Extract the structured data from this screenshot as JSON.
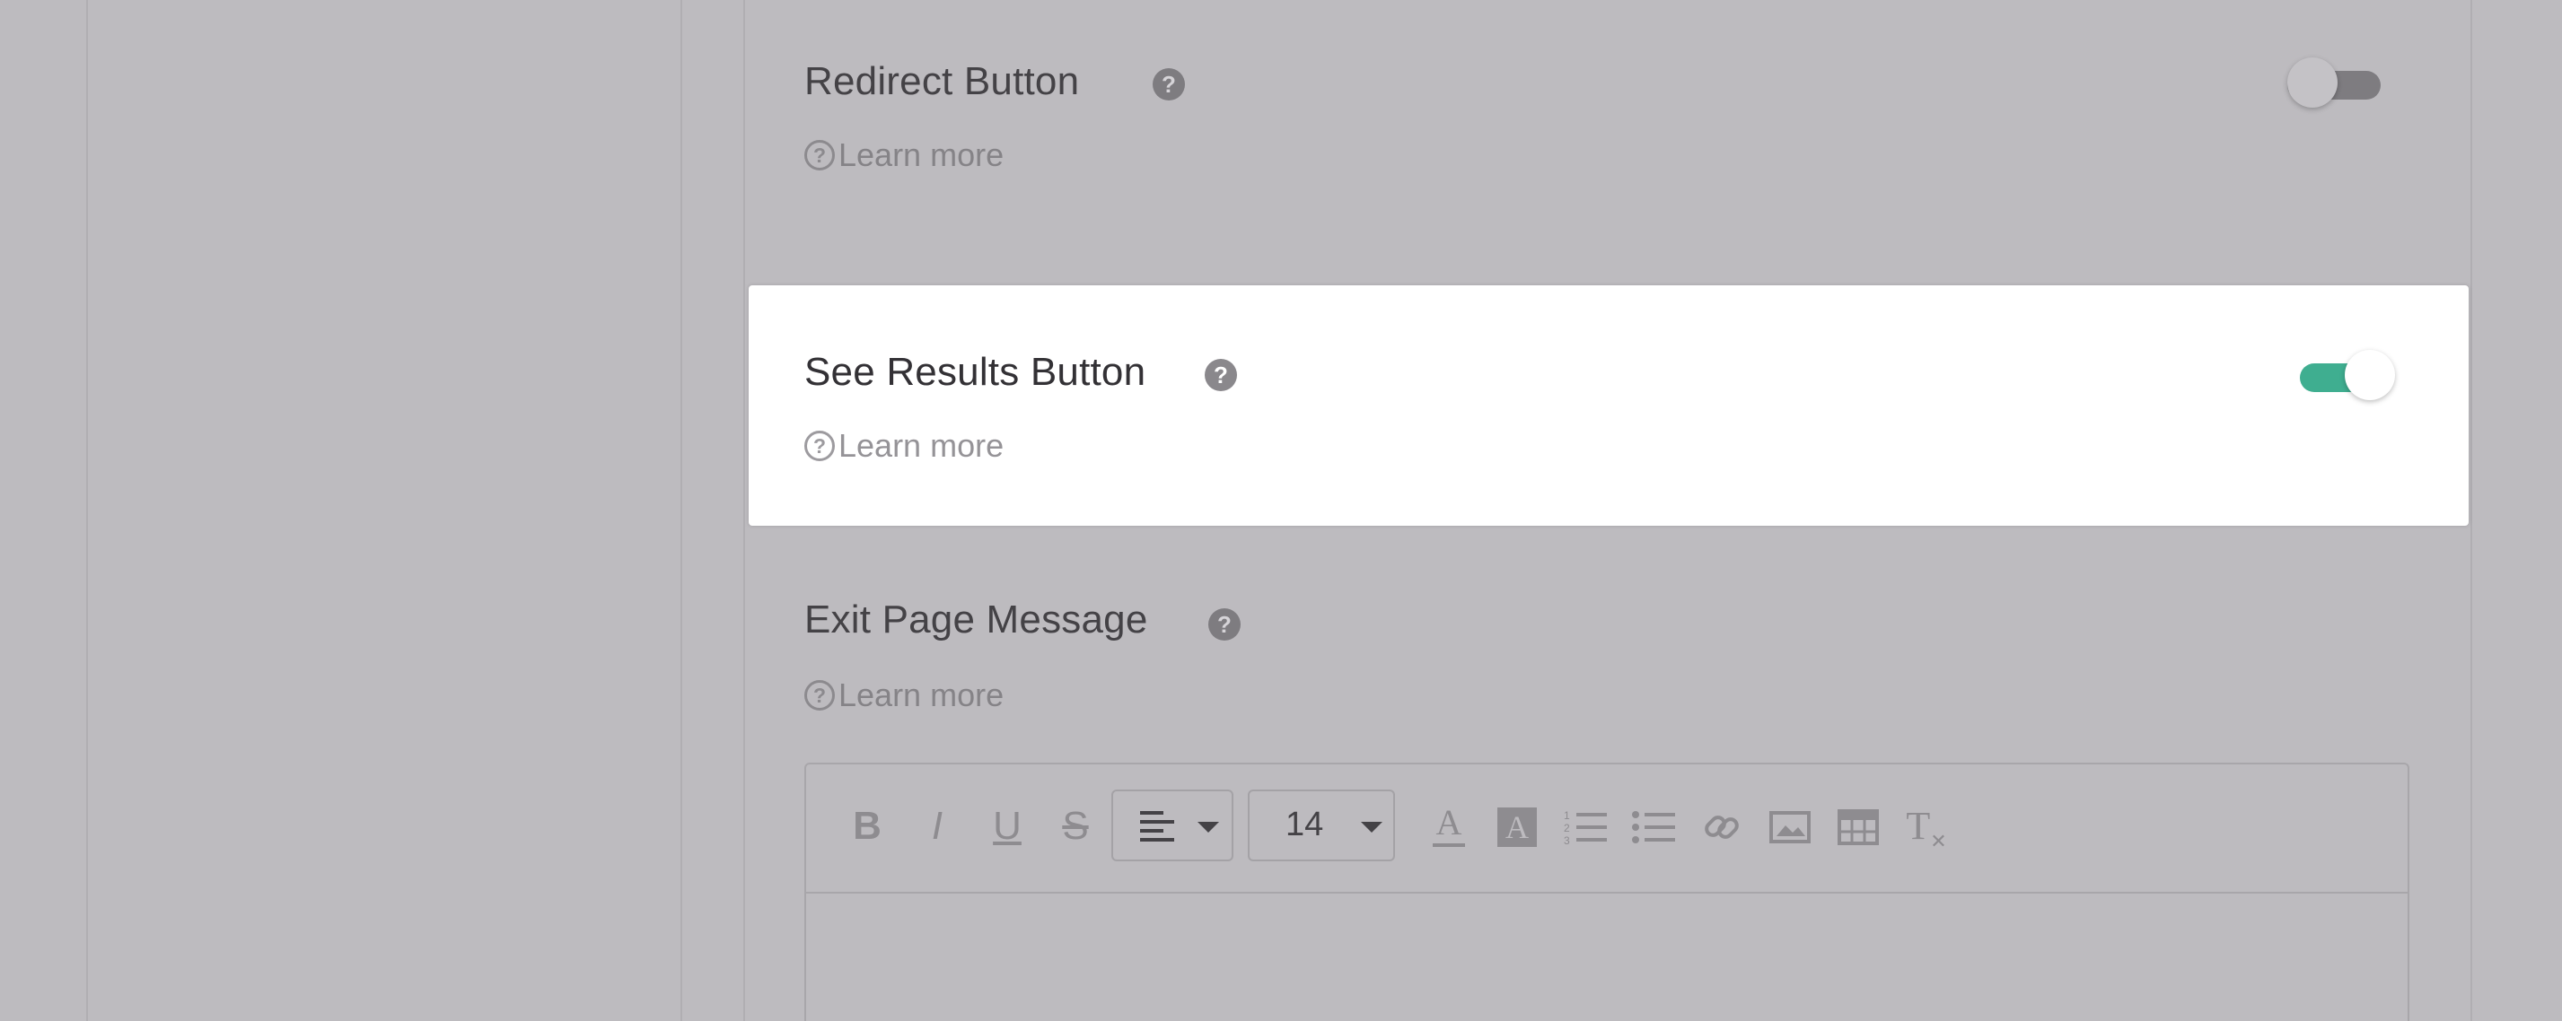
{
  "settings": {
    "redirect_button": {
      "title": "Redirect Button",
      "help": "?",
      "learn_more": "Learn more",
      "toggle_state": "off"
    },
    "see_results_button": {
      "title": "See Results Button",
      "help": "?",
      "learn_more": "Learn more",
      "toggle_state": "on"
    },
    "exit_page_message": {
      "title": "Exit Page Message",
      "help": "?",
      "learn_more": "Learn more"
    }
  },
  "learn_more_icon": "?",
  "editor": {
    "toolbar": {
      "bold": "B",
      "italic": "I",
      "underline": "U",
      "strikethrough": "S",
      "font_size": "14",
      "clear_format": "T"
    },
    "icons": [
      "bold-icon",
      "italic-icon",
      "underline-icon",
      "strikethrough-icon",
      "align-left-icon",
      "chevron-down-icon",
      "text-color-icon",
      "background-color-icon",
      "ordered-list-icon",
      "unordered-list-icon",
      "link-icon",
      "image-icon",
      "table-icon",
      "clear-format-icon"
    ]
  },
  "colors": {
    "overlay_background": "#bdbbbf",
    "card_highlight": "#ffffff",
    "toggle_on": "#3fae90",
    "toggle_off": "#7e7c80"
  }
}
